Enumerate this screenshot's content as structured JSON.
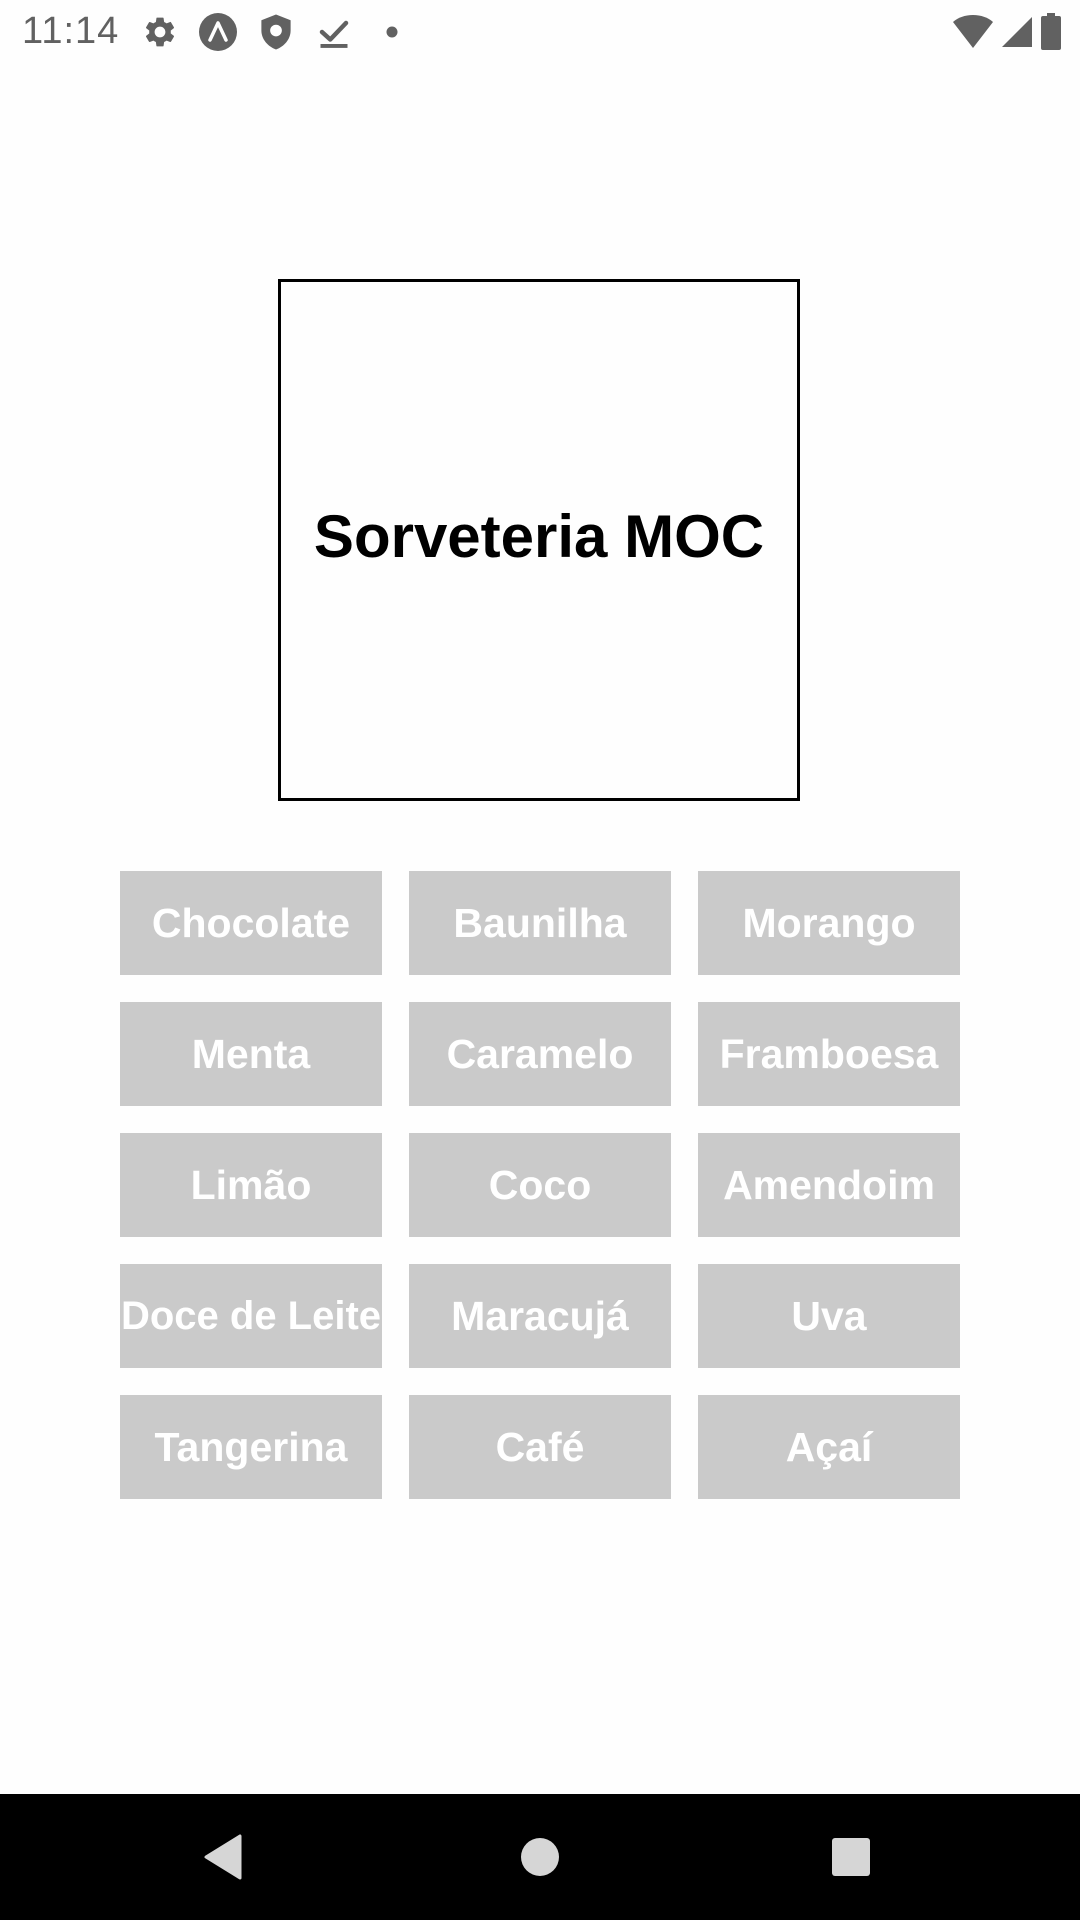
{
  "status_bar": {
    "time": "11:14",
    "left_icons": [
      "settings-icon",
      "app-a-icon",
      "shield-icon",
      "download-done-icon",
      "notification-dot-icon"
    ],
    "right_icons": [
      "wifi-icon",
      "signal-icon",
      "battery-icon"
    ],
    "icon_color": "#616161"
  },
  "title": "Sorveteria MOC",
  "flavors": [
    "Chocolate",
    "Baunilha",
    "Morango",
    "Menta",
    "Caramelo",
    "Framboesa",
    "Limão",
    "Coco",
    "Amendoim",
    "Doce de Leite",
    "Maracujá",
    "Uva",
    "Tangerina",
    "Café",
    "Açaí"
  ],
  "colors": {
    "button_bg": "#cacaca",
    "button_text": "#ffffff",
    "nav_bar_bg": "#000000",
    "nav_icon": "#d6d6d6"
  },
  "nav_bar": {
    "buttons": [
      "back-icon",
      "home-icon",
      "recents-icon"
    ]
  }
}
